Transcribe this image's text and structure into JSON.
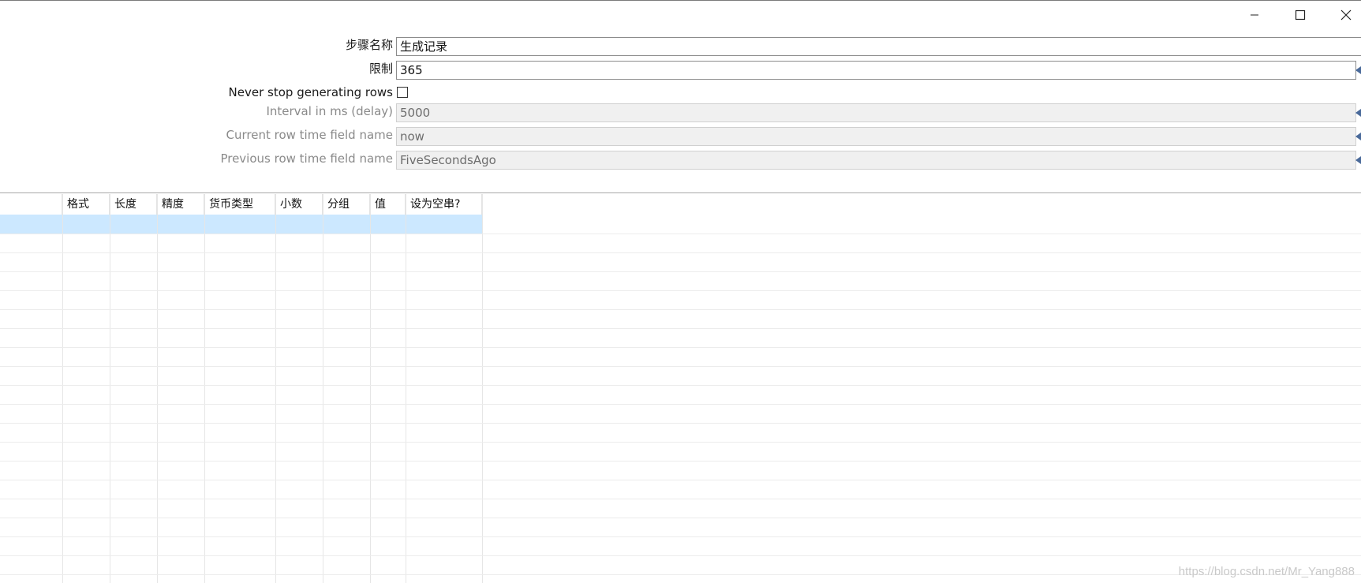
{
  "window_controls": {
    "minimize": "minimize",
    "maximize": "maximize",
    "close": "close"
  },
  "form": {
    "step_name": {
      "label": "步骤名称",
      "value": "生成记录"
    },
    "limit": {
      "label": "限制",
      "value": "365"
    },
    "never_stop": {
      "label": "Never stop generating rows",
      "checked": false
    },
    "interval": {
      "label": "Interval in ms (delay)",
      "value": "5000"
    },
    "current_row_time": {
      "label": "Current row time field name",
      "value": "now"
    },
    "previous_row_time": {
      "label": "Previous row time field name",
      "value": "FiveSecondsAgo"
    }
  },
  "grid": {
    "columns": [
      "格式",
      "长度",
      "精度",
      "货币类型",
      "小数",
      "分组",
      "值",
      "设为空串?"
    ]
  },
  "watermark": "https://blog.csdn.net/Mr_Yang888",
  "colors": {
    "selected_row": "#cce8ff",
    "disabled_field": "#f0f0f0",
    "variable_marker": "#4a6a9a"
  }
}
